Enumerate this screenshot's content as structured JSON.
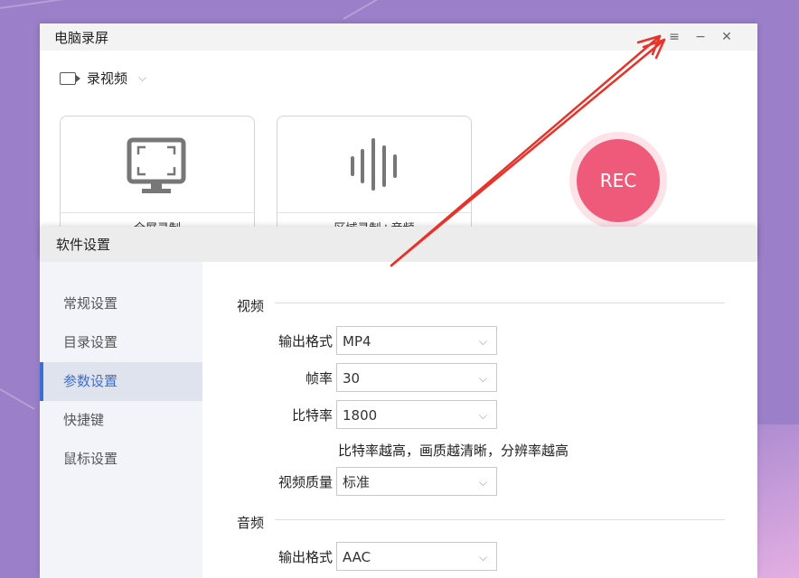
{
  "main_window": {
    "title": "电脑录屏",
    "controls": {
      "menu": "≡",
      "minimize": "−",
      "close": "✕"
    },
    "mode": {
      "label": "录视频"
    },
    "cards": [
      {
        "caption": "全屏录制",
        "icon": "monitor-fullscreen-icon"
      },
      {
        "caption": "区域录制+音频",
        "icon": "audio-wave-icon"
      }
    ],
    "rec_label": "REC"
  },
  "settings": {
    "title": "软件设置",
    "nav": [
      "常规设置",
      "目录设置",
      "参数设置",
      "快捷键",
      "鼠标设置"
    ],
    "active_nav": "参数设置",
    "video": {
      "heading": "视频",
      "format_label": "输出格式",
      "format_value": "MP4",
      "fps_label": "帧率",
      "fps_value": "30",
      "bitrate_label": "比特率",
      "bitrate_value": "1800",
      "hint": "比特率越高，画质越清晰，分辨率越高",
      "quality_label": "视频质量",
      "quality_value": "标准"
    },
    "audio": {
      "heading": "音频",
      "format_label": "输出格式",
      "format_value": "AAC"
    }
  },
  "colors": {
    "accent": "#3a6fd8",
    "rec": "#f05a7a",
    "annotation": "#e8322a"
  }
}
